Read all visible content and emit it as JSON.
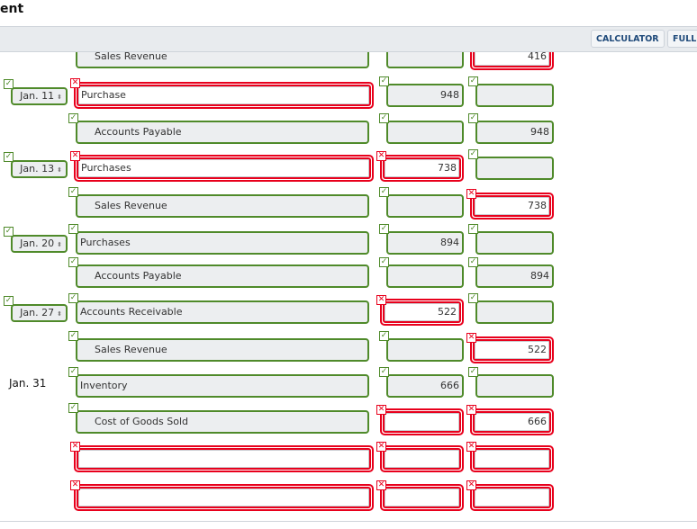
{
  "header": {
    "title": "ent"
  },
  "toolbar": {
    "calculator_label": "CALCULATOR",
    "full_label": "FULL"
  },
  "colors": {
    "correct": "#4f8a2a",
    "incorrect": "#e8001c"
  },
  "rows": [
    {
      "date": "",
      "date_type": "none",
      "account": "Sales Revenue",
      "indent": true,
      "account_status": "correct",
      "debit": "",
      "debit_status": "correct",
      "credit": "416",
      "credit_status": "incorrect"
    },
    {
      "date": "Jan. 11",
      "date_type": "select",
      "date_status": "correct",
      "account": "Purchase",
      "indent": false,
      "account_status": "incorrect",
      "debit": "948",
      "debit_status": "correct",
      "credit": "",
      "credit_status": "correct"
    },
    {
      "date": "",
      "date_type": "none",
      "account": "Accounts Payable",
      "indent": true,
      "account_status": "correct",
      "debit": "",
      "debit_status": "correct",
      "credit": "948",
      "credit_status": "correct"
    },
    {
      "date": "Jan. 13",
      "date_type": "select",
      "date_status": "correct",
      "account": "Purchases",
      "indent": false,
      "account_status": "incorrect",
      "debit": "738",
      "debit_status": "incorrect",
      "credit": "",
      "credit_status": "correct"
    },
    {
      "date": "",
      "date_type": "none",
      "account": "Sales Revenue",
      "indent": true,
      "account_status": "correct",
      "debit": "",
      "debit_status": "correct",
      "credit": "738",
      "credit_status": "incorrect"
    },
    {
      "date": "Jan. 20",
      "date_type": "select",
      "date_status": "correct",
      "account": "Purchases",
      "indent": false,
      "account_status": "correct",
      "debit": "894",
      "debit_status": "correct",
      "credit": "",
      "credit_status": "correct"
    },
    {
      "date": "",
      "date_type": "none",
      "account": "Accounts Payable",
      "indent": true,
      "account_status": "correct",
      "debit": "",
      "debit_status": "correct",
      "credit": "894",
      "credit_status": "correct"
    },
    {
      "date": "Jan. 27",
      "date_type": "select",
      "date_status": "correct",
      "account": "Accounts Receivable",
      "indent": false,
      "account_status": "correct",
      "debit": "522",
      "debit_status": "incorrect",
      "credit": "",
      "credit_status": "correct"
    },
    {
      "date": "",
      "date_type": "none",
      "account": "Sales Revenue",
      "indent": true,
      "account_status": "correct",
      "debit": "",
      "debit_status": "correct",
      "credit": "522",
      "credit_status": "incorrect"
    },
    {
      "date": "Jan. 31",
      "date_type": "text",
      "account": "Inventory",
      "indent": false,
      "account_status": "correct",
      "debit": "666",
      "debit_status": "correct",
      "credit": "",
      "credit_status": "correct"
    },
    {
      "date": "",
      "date_type": "none",
      "account": "Cost of Goods Sold",
      "indent": true,
      "account_status": "correct",
      "debit": "",
      "debit_status": "incorrect",
      "credit": "666",
      "credit_status": "incorrect"
    },
    {
      "date": "",
      "date_type": "none",
      "account": "",
      "indent": false,
      "account_status": "incorrect",
      "debit": "",
      "debit_status": "incorrect",
      "credit": "",
      "credit_status": "incorrect"
    },
    {
      "date": "",
      "date_type": "none",
      "account": "",
      "indent": false,
      "account_status": "incorrect",
      "debit": "",
      "debit_status": "incorrect",
      "credit": "",
      "credit_status": "incorrect"
    }
  ]
}
